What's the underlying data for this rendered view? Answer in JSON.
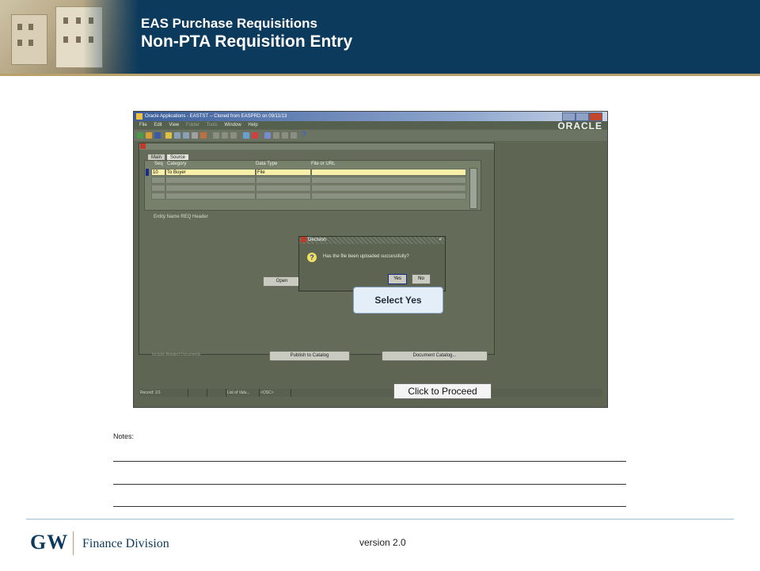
{
  "slide": {
    "title": "EAS Purchase Requisitions",
    "subtitle": "Non-PTA Requisition Entry"
  },
  "app": {
    "window_title": "Oracle Applications - EASTST -- Cloned from EASPRD on 09/11/13",
    "menu": [
      "File",
      "Edit",
      "View",
      "Folder",
      "Tools",
      "Window",
      "Help"
    ],
    "logo_text": "ORACLE",
    "tabs": [
      "Main",
      "Source"
    ],
    "columns": [
      "Seq",
      "Category",
      "Data Type",
      "File or URL"
    ],
    "rows": [
      {
        "seq": "10",
        "category": "To Buyer",
        "data_type": "File",
        "file": ""
      }
    ],
    "entity_name": "Entity Name  REQ Header",
    "open_button": "Open",
    "include_checkbox": "Include Related Documents",
    "publish_button": "Publish to Catalog",
    "document_catalog_button": "Document Catalog...",
    "status": {
      "record": "Record: 1/1",
      "list": "List of Valu...",
      "osc": "<OSC>"
    }
  },
  "dialog": {
    "title": "Decision",
    "close": "×",
    "message": "Has the file been uploaded successfully?",
    "yes": "Yes",
    "no": "No"
  },
  "callout": "Select Yes",
  "proceed_button": "Click to Proceed",
  "notes": {
    "label": "Notes:"
  },
  "footer": {
    "logo": "GW",
    "division": "Finance Division",
    "version": "version 2.0"
  },
  "colors": {
    "header_bg": "#0c3a5c",
    "header_rule": "#b9a069",
    "app_bg": "#5e6553",
    "selected_row": "#f8f0a8"
  }
}
